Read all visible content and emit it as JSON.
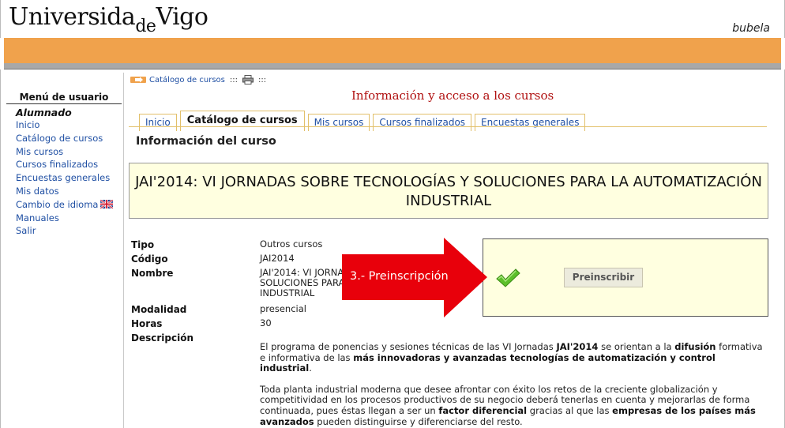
{
  "header": {
    "logo_part1": "Universida",
    "logo_de": "de",
    "logo_part2": "Vigo",
    "brand": "bubela"
  },
  "sidebar": {
    "title": "Menú de usuario",
    "role": "Alumnado",
    "items": [
      {
        "label": "Inicio"
      },
      {
        "label": "Catálogo de cursos"
      },
      {
        "label": "Mis cursos"
      },
      {
        "label": "Cursos finalizados"
      },
      {
        "label": "Encuestas generales"
      },
      {
        "label": "Mis datos"
      },
      {
        "label": "Cambio de idioma"
      },
      {
        "label": "Manuales"
      },
      {
        "label": "Salir"
      }
    ]
  },
  "breadcrumb": {
    "link": "Catálogo de cursos",
    "sep1": ":::",
    "sep2": ":::",
    "icons": [
      "arrow-icon",
      "printer-icon"
    ]
  },
  "page_heading": "Información y acceso a los cursos",
  "tabs": [
    {
      "label": "Inicio",
      "active": false
    },
    {
      "label": "Catálogo de cursos",
      "active": true
    },
    {
      "label": "Mis cursos",
      "active": false
    },
    {
      "label": "Cursos finalizados",
      "active": false
    },
    {
      "label": "Encuestas generales",
      "active": false
    }
  ],
  "section_title": "Información del curso",
  "course_title_line1": "JAI'2014: VI JORNADAS SOBRE TECNOLOGÍAS Y SOLUCIONES PARA LA AUTOMATIZACIÓN",
  "course_title_line2": "INDUSTRIAL",
  "info": {
    "tipo_label": "Tipo",
    "tipo_value": "Outros cursos",
    "codigo_label": "Código",
    "codigo_value": "JAI2014",
    "nombre_label": "Nombre",
    "nombre_line1": "JAI'2014: VI JORNA",
    "nombre_line2": "SOLUCIONES PARA",
    "nombre_line3": "INDUSTRIAL",
    "modalidad_label": "Modalidad",
    "modalidad_value": "presencial",
    "horas_label": "Horas",
    "horas_value": "30",
    "descripcion_label": "Descripción"
  },
  "description": {
    "p1": {
      "t1": "El programa de ponencias y sesiones técnicas de las VI Jornadas ",
      "b1": "JAI'2014",
      "t2": " se orientan a la ",
      "b2": "difusión",
      "t3": " formativa e informativa de las ",
      "b3": "más innovadoras y avanzadas tecnologías de automatización y control industrial",
      "t4": "."
    },
    "p2": {
      "t1": "Toda planta industrial moderna que desee afrontar con éxito los retos de la creciente globalización y competitividad en los procesos productivos de su negocio deberá tenerlas en cuenta y mejorarlas de forma continuada, pues éstas llegan a ser un ",
      "b1": "factor diferencial",
      "t2": " gracias al que las ",
      "b2": "empresas de los países más avanzados",
      "t3": " pueden distinguirse y diferenciarse del resto."
    }
  },
  "preinscription": {
    "button_label": "Preinscribir",
    "icon": "checkmark-icon"
  },
  "callout": {
    "label": "3.- Preinscripción",
    "color": "#e8000b"
  },
  "colors": {
    "orange_bar": "#f0a24c",
    "link": "#1f4fa3",
    "heading_red": "#b01010",
    "box_bg": "#ffffe0"
  }
}
